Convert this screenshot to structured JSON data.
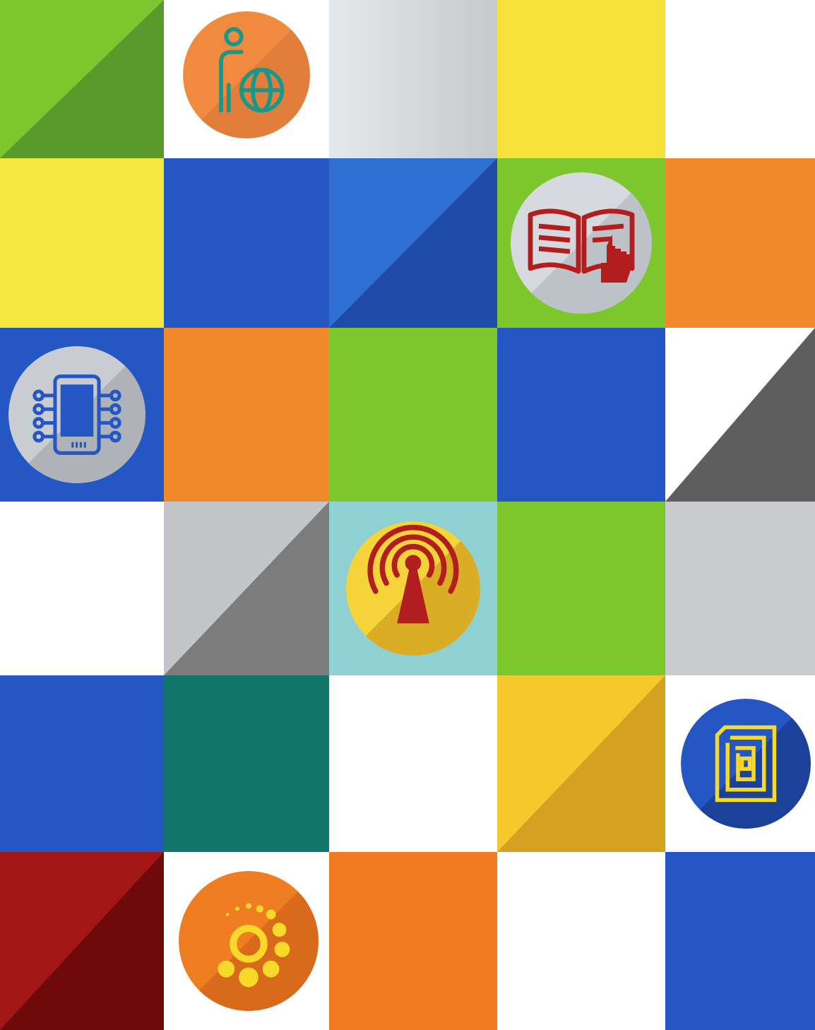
{
  "palette": {
    "green": "#7cc72e",
    "green_dark": "#5a9a2c",
    "white": "#ffffff",
    "yellow": "#f6e03a",
    "blue": "#2456c4",
    "blue_dark": "#1e4aa8",
    "orange": "#f08a2a",
    "orange_dark": "#d46a1c",
    "grey": "#c3c5c8",
    "grey_dark": "#6e6e6e",
    "teal": "#12756a",
    "red": "#a31616",
    "red_dark": "#6e0a0a",
    "mustard": "#f5c92c",
    "mustard_dark": "#d4a220",
    "icon_red": "#b21d1d",
    "icon_teal": "#19988a",
    "icon_yellow": "#f7d92a"
  },
  "grid": {
    "rows": 6,
    "columns": 5,
    "tiles": [
      {
        "row": 1,
        "col": 1,
        "style": "split",
        "color": "green",
        "shade": "green_dark",
        "icon": null
      },
      {
        "row": 1,
        "col": 2,
        "style": "solid",
        "color": "white",
        "icon": "person-globe-icon"
      },
      {
        "row": 1,
        "col": 3,
        "style": "solid",
        "color": "grey",
        "icon": null
      },
      {
        "row": 1,
        "col": 4,
        "style": "solid",
        "color": "yellow",
        "icon": null
      },
      {
        "row": 1,
        "col": 5,
        "style": "solid",
        "color": "white",
        "icon": null
      },
      {
        "row": 2,
        "col": 1,
        "style": "solid",
        "color": "yellow",
        "icon": null
      },
      {
        "row": 2,
        "col": 2,
        "style": "solid",
        "color": "blue",
        "icon": null
      },
      {
        "row": 2,
        "col": 3,
        "style": "split",
        "color": "blue",
        "shade": "blue_dark",
        "icon": null
      },
      {
        "row": 2,
        "col": 4,
        "style": "solid",
        "color": "green",
        "icon": "open-book-icon"
      },
      {
        "row": 2,
        "col": 5,
        "style": "solid",
        "color": "orange",
        "icon": null
      },
      {
        "row": 3,
        "col": 1,
        "style": "solid",
        "color": "blue",
        "icon": "microchip-tablet-icon"
      },
      {
        "row": 3,
        "col": 2,
        "style": "solid",
        "color": "orange",
        "icon": null
      },
      {
        "row": 3,
        "col": 3,
        "style": "solid",
        "color": "green",
        "icon": null
      },
      {
        "row": 3,
        "col": 4,
        "style": "solid",
        "color": "blue",
        "icon": null
      },
      {
        "row": 3,
        "col": 5,
        "style": "split",
        "color": "white",
        "shade": "grey_dark",
        "icon": null
      },
      {
        "row": 4,
        "col": 1,
        "style": "solid",
        "color": "white",
        "icon": null
      },
      {
        "row": 4,
        "col": 2,
        "style": "split",
        "color": "grey",
        "shade": "grey_dark",
        "icon": null
      },
      {
        "row": 4,
        "col": 3,
        "style": "solid",
        "color": "teal_light",
        "icon": "broadcast-tower-icon"
      },
      {
        "row": 4,
        "col": 4,
        "style": "solid",
        "color": "green",
        "icon": null
      },
      {
        "row": 4,
        "col": 5,
        "style": "solid",
        "color": "grey",
        "icon": null
      },
      {
        "row": 5,
        "col": 1,
        "style": "solid",
        "color": "blue",
        "icon": null
      },
      {
        "row": 5,
        "col": 2,
        "style": "solid",
        "color": "teal",
        "icon": null
      },
      {
        "row": 5,
        "col": 3,
        "style": "solid",
        "color": "white",
        "icon": null
      },
      {
        "row": 5,
        "col": 4,
        "style": "split",
        "color": "mustard",
        "shade": "mustard_dark",
        "icon": null
      },
      {
        "row": 5,
        "col": 5,
        "style": "solid",
        "color": "white",
        "icon": "rfid-tag-icon"
      },
      {
        "row": 6,
        "col": 1,
        "style": "split",
        "color": "red",
        "shade": "red_dark",
        "icon": null
      },
      {
        "row": 6,
        "col": 2,
        "style": "solid",
        "color": "white",
        "icon": "loading-dots-icon"
      },
      {
        "row": 6,
        "col": 3,
        "style": "solid",
        "color": "orange",
        "icon": null
      },
      {
        "row": 6,
        "col": 4,
        "style": "solid",
        "color": "white",
        "icon": null
      },
      {
        "row": 6,
        "col": 5,
        "style": "solid",
        "color": "blue",
        "icon": null
      }
    ]
  }
}
